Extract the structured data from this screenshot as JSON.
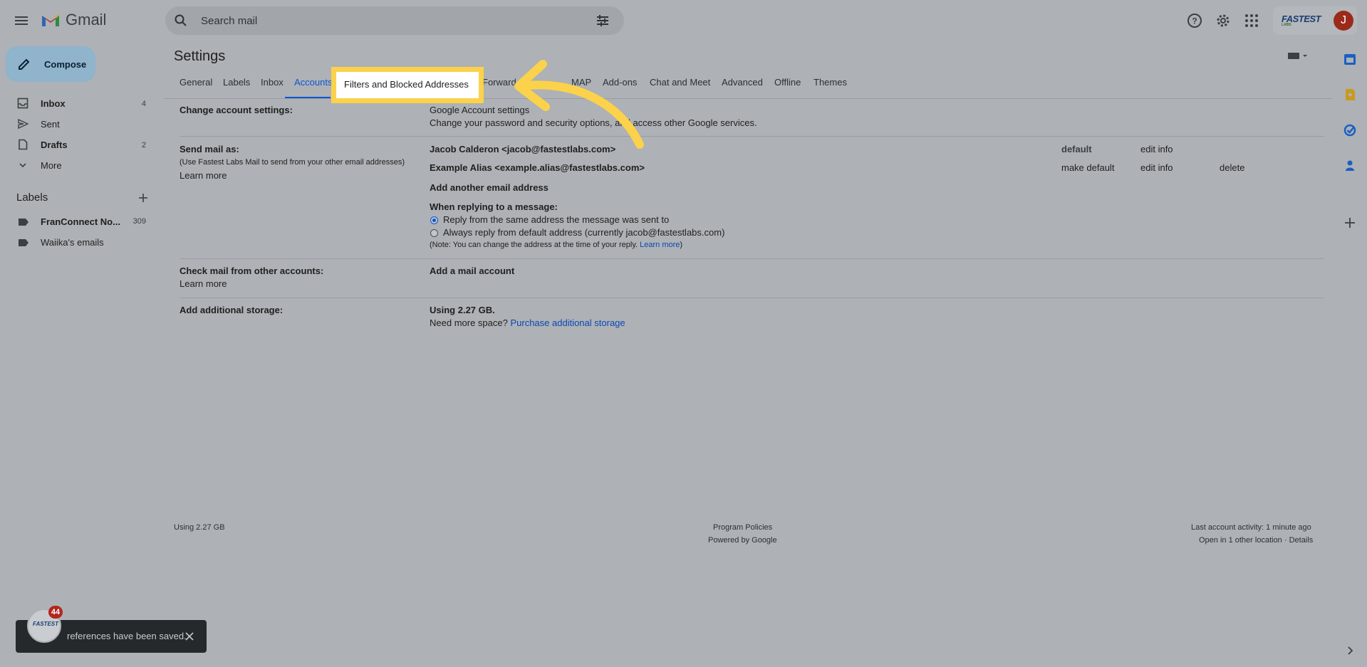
{
  "app": {
    "name": "Gmail"
  },
  "search": {
    "placeholder": "Search mail"
  },
  "brand": {
    "logo_text": "FASTEST",
    "logo_sub": "LABS",
    "avatar_initial": "J"
  },
  "compose": {
    "label": "Compose"
  },
  "nav": [
    {
      "label": "Inbox",
      "count": "4",
      "icon": "inbox-icon",
      "bold": true
    },
    {
      "label": "Sent",
      "count": "",
      "icon": "send-icon",
      "bold": false
    },
    {
      "label": "Drafts",
      "count": "2",
      "icon": "draft-icon",
      "bold": true
    },
    {
      "label": "More",
      "count": "",
      "icon": "chevron-down-icon",
      "bold": false
    }
  ],
  "labels": {
    "title": "Labels",
    "items": [
      {
        "label": "FranConnect No...",
        "count": "309",
        "bold": true
      },
      {
        "label": "Waiika's emails",
        "count": "",
        "bold": false
      }
    ]
  },
  "settings": {
    "title": "Settings",
    "tabs": [
      "General",
      "Labels",
      "Inbox",
      "Accounts",
      "Filters and Blocked Addresses",
      "Forwarding and POP/IMAP",
      "Add-ons",
      "Chat and Meet",
      "Advanced",
      "Offline",
      "Themes"
    ],
    "active_tab": "Accounts",
    "highlighted_tab": "Filters and Blocked Addresses",
    "visible_tab_fragments": {
      "forwarding": "Forward",
      "imap": "MAP"
    },
    "change_account": {
      "label": "Change account settings:",
      "link": "Google Account settings",
      "desc": "Change your password and security options, and access other Google services."
    },
    "send_mail": {
      "label": "Send mail as:",
      "sub": "(Use Fastest Labs Mail to send from your other email addresses)",
      "learn_more": "Learn more",
      "addresses": [
        {
          "address": "Jacob Calderon <jacob@fastestlabs.com>",
          "status": "default",
          "edit": "edit info",
          "make_default": "",
          "delete": ""
        },
        {
          "address": "Example Alias <example.alias@fastestlabs.com>",
          "status": "",
          "edit": "edit info",
          "make_default": "make default",
          "delete": "delete"
        }
      ],
      "add_another": "Add another email address",
      "reply_title": "When replying to a message:",
      "reply_same": "Reply from the same address the message was sent to",
      "reply_default": "Always reply from default address (currently jacob@fastestlabs.com)",
      "note": "(Note: You can change the address at the time of your reply.",
      "note_link": "Learn more",
      "note_end": ")"
    },
    "check_mail": {
      "label": "Check mail from other accounts:",
      "learn_more": "Learn more",
      "add_account": "Add a mail account"
    },
    "storage": {
      "label": "Add additional storage:",
      "using": "Using 2.27 GB.",
      "need_more": "Need more space?",
      "purchase": "Purchase additional storage"
    }
  },
  "footer": {
    "usage": "Using 2.27 GB",
    "program_policies": "Program Policies",
    "powered_by": "Powered by Google",
    "last_activity": "Last account activity: 1 minute ago",
    "open_in": "Open in 1 other location · Details"
  },
  "toast": {
    "text": "references have been saved."
  },
  "badge": {
    "count": "44",
    "logo": "FASTEST"
  },
  "colors": {
    "accent": "#0b57d0",
    "highlight": "#fbd24a",
    "overlay_bg": "#aeb1b5",
    "toast_bg": "#26292c"
  }
}
